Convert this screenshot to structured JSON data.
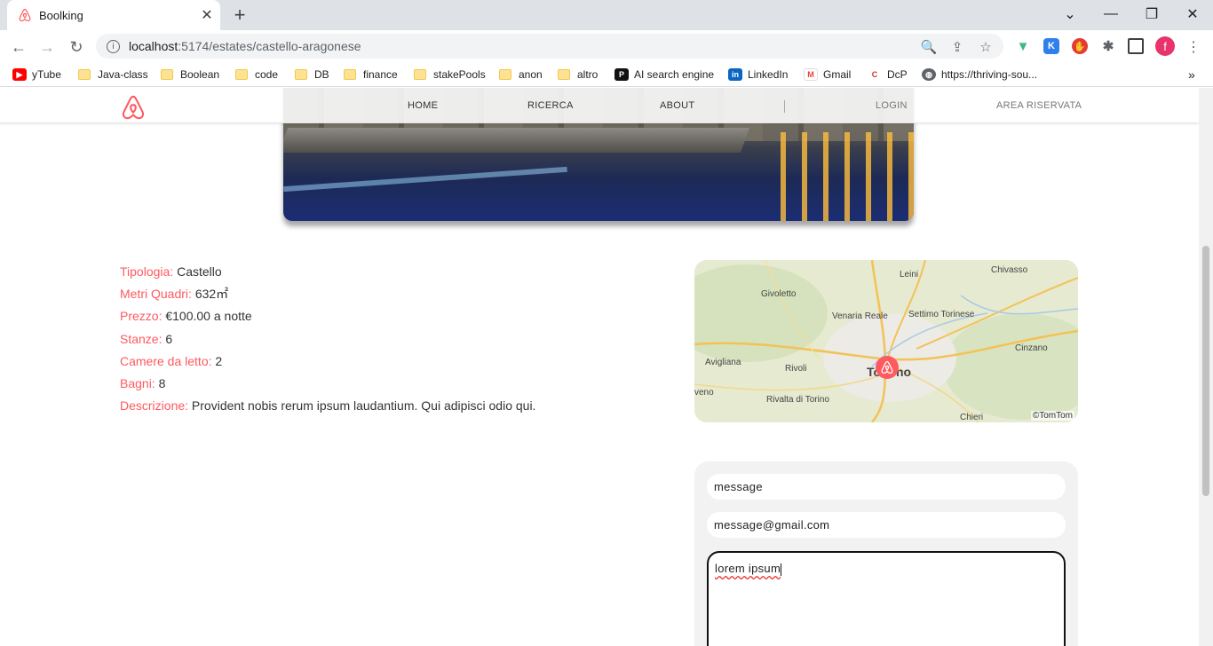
{
  "browser": {
    "tab_title": "Boolking",
    "url_host": "localhost",
    "url_path": ":5174/estates/castello-aragonese",
    "profile_initial": "f",
    "bookmarks": [
      "yTube",
      "Java-class",
      "Boolean",
      "code",
      "DB",
      "finance",
      "stakePools",
      "anon",
      "altro",
      "AI search engine",
      "LinkedIn",
      "Gmail",
      "DcP",
      "https://thriving-sou..."
    ],
    "more_bookmarks": "»"
  },
  "navbar": {
    "home": "HOME",
    "search": "RICERCA",
    "about": "ABOUT",
    "login": "LOGIN",
    "reserved": "AREA RISERVATA"
  },
  "details": {
    "type_label": "Tipologia:",
    "type_value": "Castello",
    "area_label": "Metri Quadri:",
    "area_value": "632㎡",
    "price_label": "Prezzo:",
    "price_value": "€100.00 a notte",
    "rooms_label": "Stanze:",
    "rooms_value": "6",
    "bedrooms_label": "Camere da letto:",
    "bedrooms_value": "2",
    "bathrooms_label": "Bagni:",
    "bathrooms_value": "8",
    "description_label": "Descrizione:",
    "description_value": "Provident nobis rerum ipsum laudantium. Qui adipisci odio qui."
  },
  "map": {
    "places": [
      "Chivasso",
      "Leini",
      "Givoletto",
      "Venaria Reale",
      "Settimo Torinese",
      "Cinzano",
      "Avigliana",
      "Rivoli",
      "To",
      "no",
      "veno",
      "Rivalta di Torino",
      "Chieri"
    ],
    "attribution": "©TomTom"
  },
  "contact_form": {
    "name_value": "message",
    "email_value": "message@gmail.com",
    "message_value": "lorem ipsum"
  },
  "colors": {
    "accent": "#ff5a5f"
  }
}
